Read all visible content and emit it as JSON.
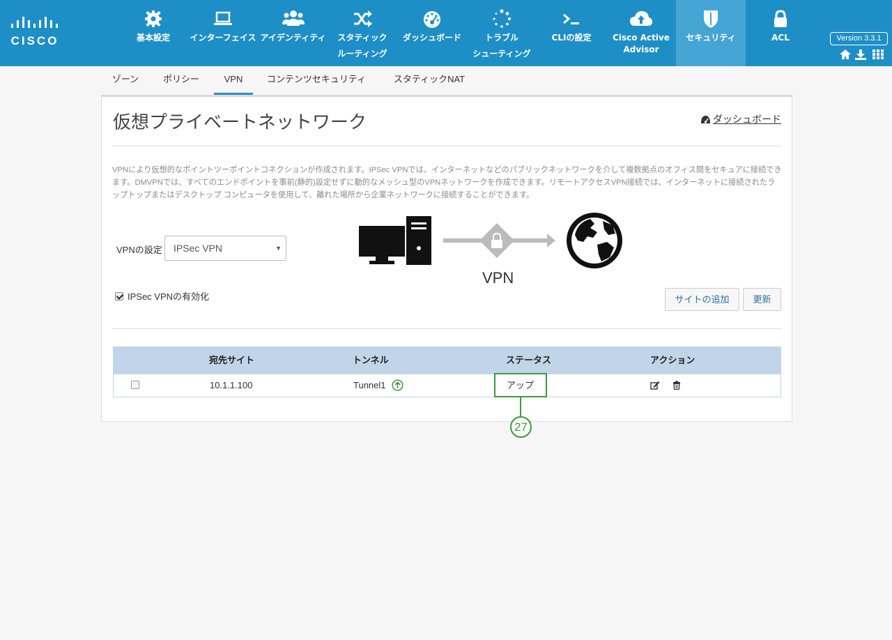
{
  "brand": {
    "logo_text": "CISCO"
  },
  "nav": {
    "items": [
      {
        "label": "基本設定",
        "icon": "gear-icon"
      },
      {
        "label": "インターフェイス",
        "icon": "laptop-icon"
      },
      {
        "label": "アイデンティティ",
        "icon": "users-icon"
      },
      {
        "label": "スタティック",
        "label2": "ルーティング",
        "icon": "shuffle-icon"
      },
      {
        "label": "ダッシュボード",
        "icon": "gauge-icon"
      },
      {
        "label": "トラブル",
        "label2": "シューティング",
        "icon": "spinner-icon"
      },
      {
        "label": "CLIの設定",
        "icon": "terminal-icon"
      },
      {
        "label": "Cisco Active",
        "label2": "Advisor",
        "icon": "cloud-upload-icon"
      },
      {
        "label": "セキュリティ",
        "icon": "shield-icon"
      },
      {
        "label": "ACL",
        "icon": "lock-icon"
      }
    ],
    "active": "セキュリティ",
    "version": "Version 3.3.1"
  },
  "subtabs": {
    "items": [
      "ゾーン",
      "ポリシー",
      "VPN",
      "コンテンツセキュリティ",
      "スタティックNAT"
    ],
    "active": "VPN"
  },
  "page": {
    "title": "仮想プライベートネットワーク",
    "dashboard_link": "ダッシュボード",
    "description": "VPNにより仮想的なポイントツーポイントコネクションが作成されます。IPSec VPNでは、インターネットなどのパブリックネットワークを介して複数拠点のオフィス間をセキュアに接続できます。DMVPNでは、すべてのエンドポイントを事前(静的)設定せずに動的なメッシュ型のVPNネットワークを作成できます。リモートアクセスVPN接続では、インターネットに接続されたラップトップまたはデスクトップ コンピュータを使用して、離れた場所から企業ネットワークに接続することができます。",
    "vpn_setting_label": "VPNの設定",
    "vpn_select_value": "IPSec VPN",
    "enable_label": "IPSec VPNの有効化",
    "enable_checked": true,
    "diagram_caption": "VPN",
    "add_site_button": "サイトの追加",
    "refresh_button": "更新"
  },
  "table": {
    "columns": [
      "宛先サイト",
      "トンネル",
      "ステータス",
      "アクション"
    ],
    "rows": [
      {
        "site": "10.1.1.100",
        "tunnel": "Tunnel1",
        "status": "アップ"
      }
    ]
  },
  "callout": {
    "number": "27",
    "color": "#3a9a3a"
  },
  "colors": {
    "topbar": "#1e8fc6",
    "active_nav": "#45a5d4",
    "table_header": "#c1d5e9",
    "status_up": "#3a9a3a"
  }
}
